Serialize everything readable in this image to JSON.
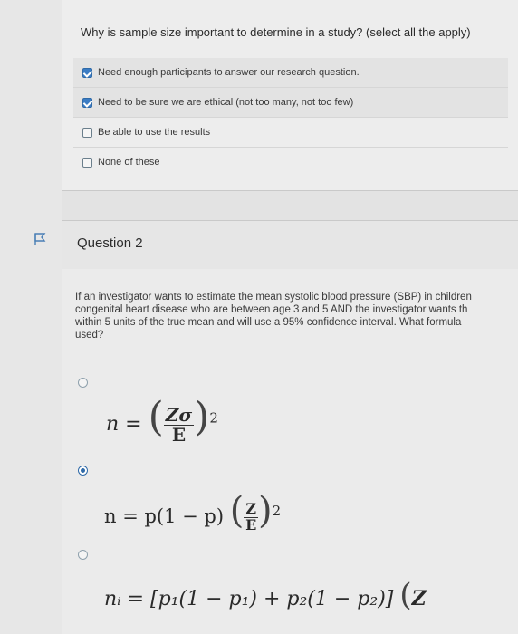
{
  "question1": {
    "prompt": "Why is sample size important to determine in a study? (select all the apply)",
    "options": [
      {
        "label": "Need enough participants to answer our research question.",
        "checked": true
      },
      {
        "label": "Need to be sure we are ethical (not too many, not too few)",
        "checked": true
      },
      {
        "label": "Be able to use the results",
        "checked": false
      },
      {
        "label": "None of these",
        "checked": false
      }
    ]
  },
  "question2": {
    "title": "Question 2",
    "prompt_lines": [
      "If an investigator wants to estimate the mean systolic blood pressure (SBP) in children",
      "congenital heart disease who are between age 3 and 5 AND the investigator wants th",
      "within 5 units of the true mean and will use a 95% confidence interval. What formula",
      "used?"
    ],
    "formulas": {
      "a": {
        "lhs": "n =",
        "num": "Zσ",
        "den": "E",
        "exp": "2"
      },
      "b": {
        "lhs": "n = p(1 − p)",
        "num": "Z",
        "den": "E",
        "exp": "2"
      },
      "c": {
        "lhs": "nᵢ = [p₁(1 − p₁) + p₂(1 − p₂)]",
        "tail": "Z"
      }
    },
    "selected_option": "b"
  },
  "colors": {
    "accent": "#2f6aa8",
    "checkbox": "#3b7cc4",
    "background": "#e3e3e3"
  }
}
